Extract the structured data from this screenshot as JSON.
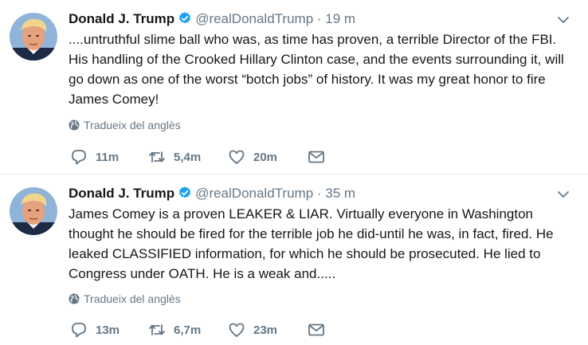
{
  "tweets": [
    {
      "name": "Donald J. Trump",
      "handle": "@realDonaldTrump",
      "separator": "·",
      "time": "19 m",
      "text": "....untruthful slime ball who was, as time has proven, a terrible Director of the FBI. His handling of the Crooked Hillary Clinton case, and the events surrounding it, will go down as one of the worst “botch jobs” of history. It was my great honor to fire James Comey!",
      "translate_label": "Tradueix del anglès",
      "replies": "11m",
      "retweets": "5,4m",
      "likes": "20m"
    },
    {
      "name": "Donald J. Trump",
      "handle": "@realDonaldTrump",
      "separator": "·",
      "time": "35 m",
      "text": "James Comey is a proven LEAKER & LIAR. Virtually everyone in Washington thought he should be fired for the terrible job he did-until he was, in fact, fired. He leaked CLASSIFIED information, for which he should be prosecuted. He lied to Congress under OATH. He is a weak and.....",
      "translate_label": "Tradueix del anglès",
      "replies": "13m",
      "retweets": "6,7m",
      "likes": "23m"
    }
  ],
  "colors": {
    "text": "#14171a",
    "secondary": "#657786",
    "verified": "#1da1f2",
    "divider": "#e6ecf0"
  },
  "icons": [
    "verified-badge-icon",
    "chevron-down-icon",
    "globe-icon",
    "reply-icon",
    "retweet-icon",
    "heart-icon",
    "envelope-icon"
  ]
}
